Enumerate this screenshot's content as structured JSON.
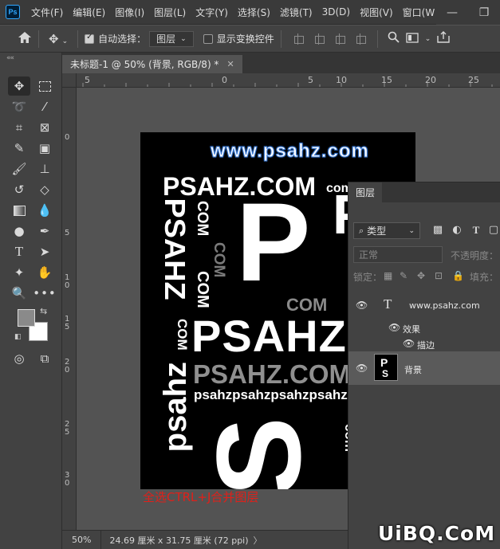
{
  "app": {
    "logo": "Ps"
  },
  "menu": [
    "文件(F)",
    "编辑(E)",
    "图像(I)",
    "图层(L)",
    "文字(Y)",
    "选择(S)",
    "滤镜(T)",
    "3D(D)",
    "视图(V)",
    "窗口(W"
  ],
  "window_controls": {
    "minimize": "—",
    "restore": "❐"
  },
  "options_bar": {
    "home_icon": "home-icon",
    "auto_select_label": "自动选择：",
    "auto_select_checked": true,
    "auto_select_target": "图层",
    "show_transform_label": "显示变换控件",
    "show_transform_checked": false
  },
  "toolbar": {
    "collapse_glyph": "««"
  },
  "document": {
    "tab_title": "未标题-1 @ 50% (背景, RGB/8) *",
    "close_glyph": "✕",
    "zoom": "50%",
    "size": "24.69 厘米 x 31.75 厘米 (72 ppi)",
    "status_arrow": "〉"
  },
  "rulers": {
    "top": [
      "5",
      "0",
      "5",
      "10",
      "15",
      "20",
      "25"
    ],
    "left": [
      "0",
      "5",
      "1 0",
      "1 5",
      "2 0",
      "2 5",
      "3 0"
    ]
  },
  "artwork": {
    "url_text": "www.psahz.com",
    "psahz_com_top": "PSAHZ.COM",
    "com_small_top": "com",
    "psahz_vertical": "PSAHZ",
    "com_vertical_1": "COM",
    "com_vertical_gray": "COM",
    "com_vertical_2": "COM",
    "com_vertical_3": "COM",
    "big_p": "P",
    "com_gray": "COM",
    "psahz_big": "PSAHZ",
    "psahz_com_gray": "PSAHZ.COM",
    "psahz_lower_vertical": "psahz",
    "psahz_repeat": "psahzpsahzpsahzpsahzpsa",
    "big_s": "S",
    "com_right_vertical": "com",
    "p_right_fragment": "P"
  },
  "caption": "全选CTRL+J合并图层",
  "layers_panel": {
    "tab_label": "图层",
    "filter_label": "类型",
    "blend_mode": "正常",
    "opacity_label": "不透明度：",
    "lock_label": "锁定：",
    "fill_label": "填充：",
    "layers": [
      {
        "name": "www.psahz.com",
        "type": "text",
        "thumb_glyph": "T"
      },
      {
        "name": "效果",
        "type": "effects"
      },
      {
        "name": "描边",
        "type": "effect"
      },
      {
        "name": "背景",
        "type": "image"
      }
    ]
  },
  "watermark": "UiBQ.CoM"
}
